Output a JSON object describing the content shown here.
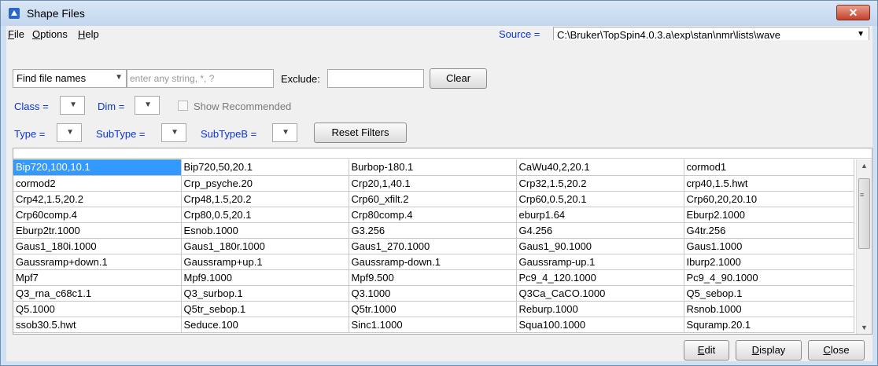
{
  "window": {
    "title": "Shape Files",
    "close_symbol": "✕"
  },
  "menu": {
    "items": [
      "File",
      "Options",
      "Help"
    ]
  },
  "source": {
    "label": "Source =",
    "value": "C:\\Bruker\\TopSpin4.0.3.a\\exp\\stan\\nmr\\lists\\wave"
  },
  "filter": {
    "mode": "Find file names",
    "search_placeholder": "enter any string, *, ?",
    "exclude_label": "Exclude:",
    "clear_label": "Clear",
    "class_label": "Class =",
    "dim_label": "Dim =",
    "show_recommended": "Show Recommended",
    "type_label": "Type =",
    "subtype_label": "SubType =",
    "subtypeb_label": "SubTypeB =",
    "reset_label": "Reset Filters"
  },
  "files": [
    [
      "Bip720,100,10.1",
      "Bip720,50,20.1",
      "Burbop-180.1",
      "CaWu40,2,20.1",
      "cormod1"
    ],
    [
      "cormod2",
      "Crp_psyche.20",
      "Crp20,1,40.1",
      "Crp32,1.5,20.2",
      "crp40,1.5.hwt"
    ],
    [
      "Crp42,1.5,20.2",
      "Crp48,1.5,20.2",
      "Crp60_xfilt.2",
      "Crp60,0.5,20.1",
      "Crp60,20,20.10"
    ],
    [
      "Crp60comp.4",
      "Crp80,0.5,20.1",
      "Crp80comp.4",
      "eburp1.64",
      "Eburp2.1000"
    ],
    [
      "Eburp2tr.1000",
      "Esnob.1000",
      "G3.256",
      "G4.256",
      "G4tr.256"
    ],
    [
      "Gaus1_180i.1000",
      "Gaus1_180r.1000",
      "Gaus1_270.1000",
      "Gaus1_90.1000",
      "Gaus1.1000"
    ],
    [
      "Gaussramp+down.1",
      "Gaussramp+up.1",
      "Gaussramp-down.1",
      "Gaussramp-up.1",
      "Iburp2.1000"
    ],
    [
      "Mpf7",
      "Mpf9.1000",
      "Mpf9.500",
      "Pc9_4_120.1000",
      "Pc9_4_90.1000"
    ],
    [
      "Q3_rna_c68c1.1",
      "Q3_surbop.1",
      "Q3.1000",
      "Q3Ca_CaCO.1000",
      "Q5_sebop.1"
    ],
    [
      "Q5.1000",
      "Q5tr_sebop.1",
      "Q5tr.1000",
      "Reburp.1000",
      "Rsnob.1000"
    ],
    [
      "ssob30.5.hwt",
      "Seduce.100",
      "Sinc1.1000",
      "Squa100.1000",
      "Squramp.20.1"
    ]
  ],
  "buttons": {
    "edit": "Edit",
    "display": "Display",
    "close": "Close"
  }
}
